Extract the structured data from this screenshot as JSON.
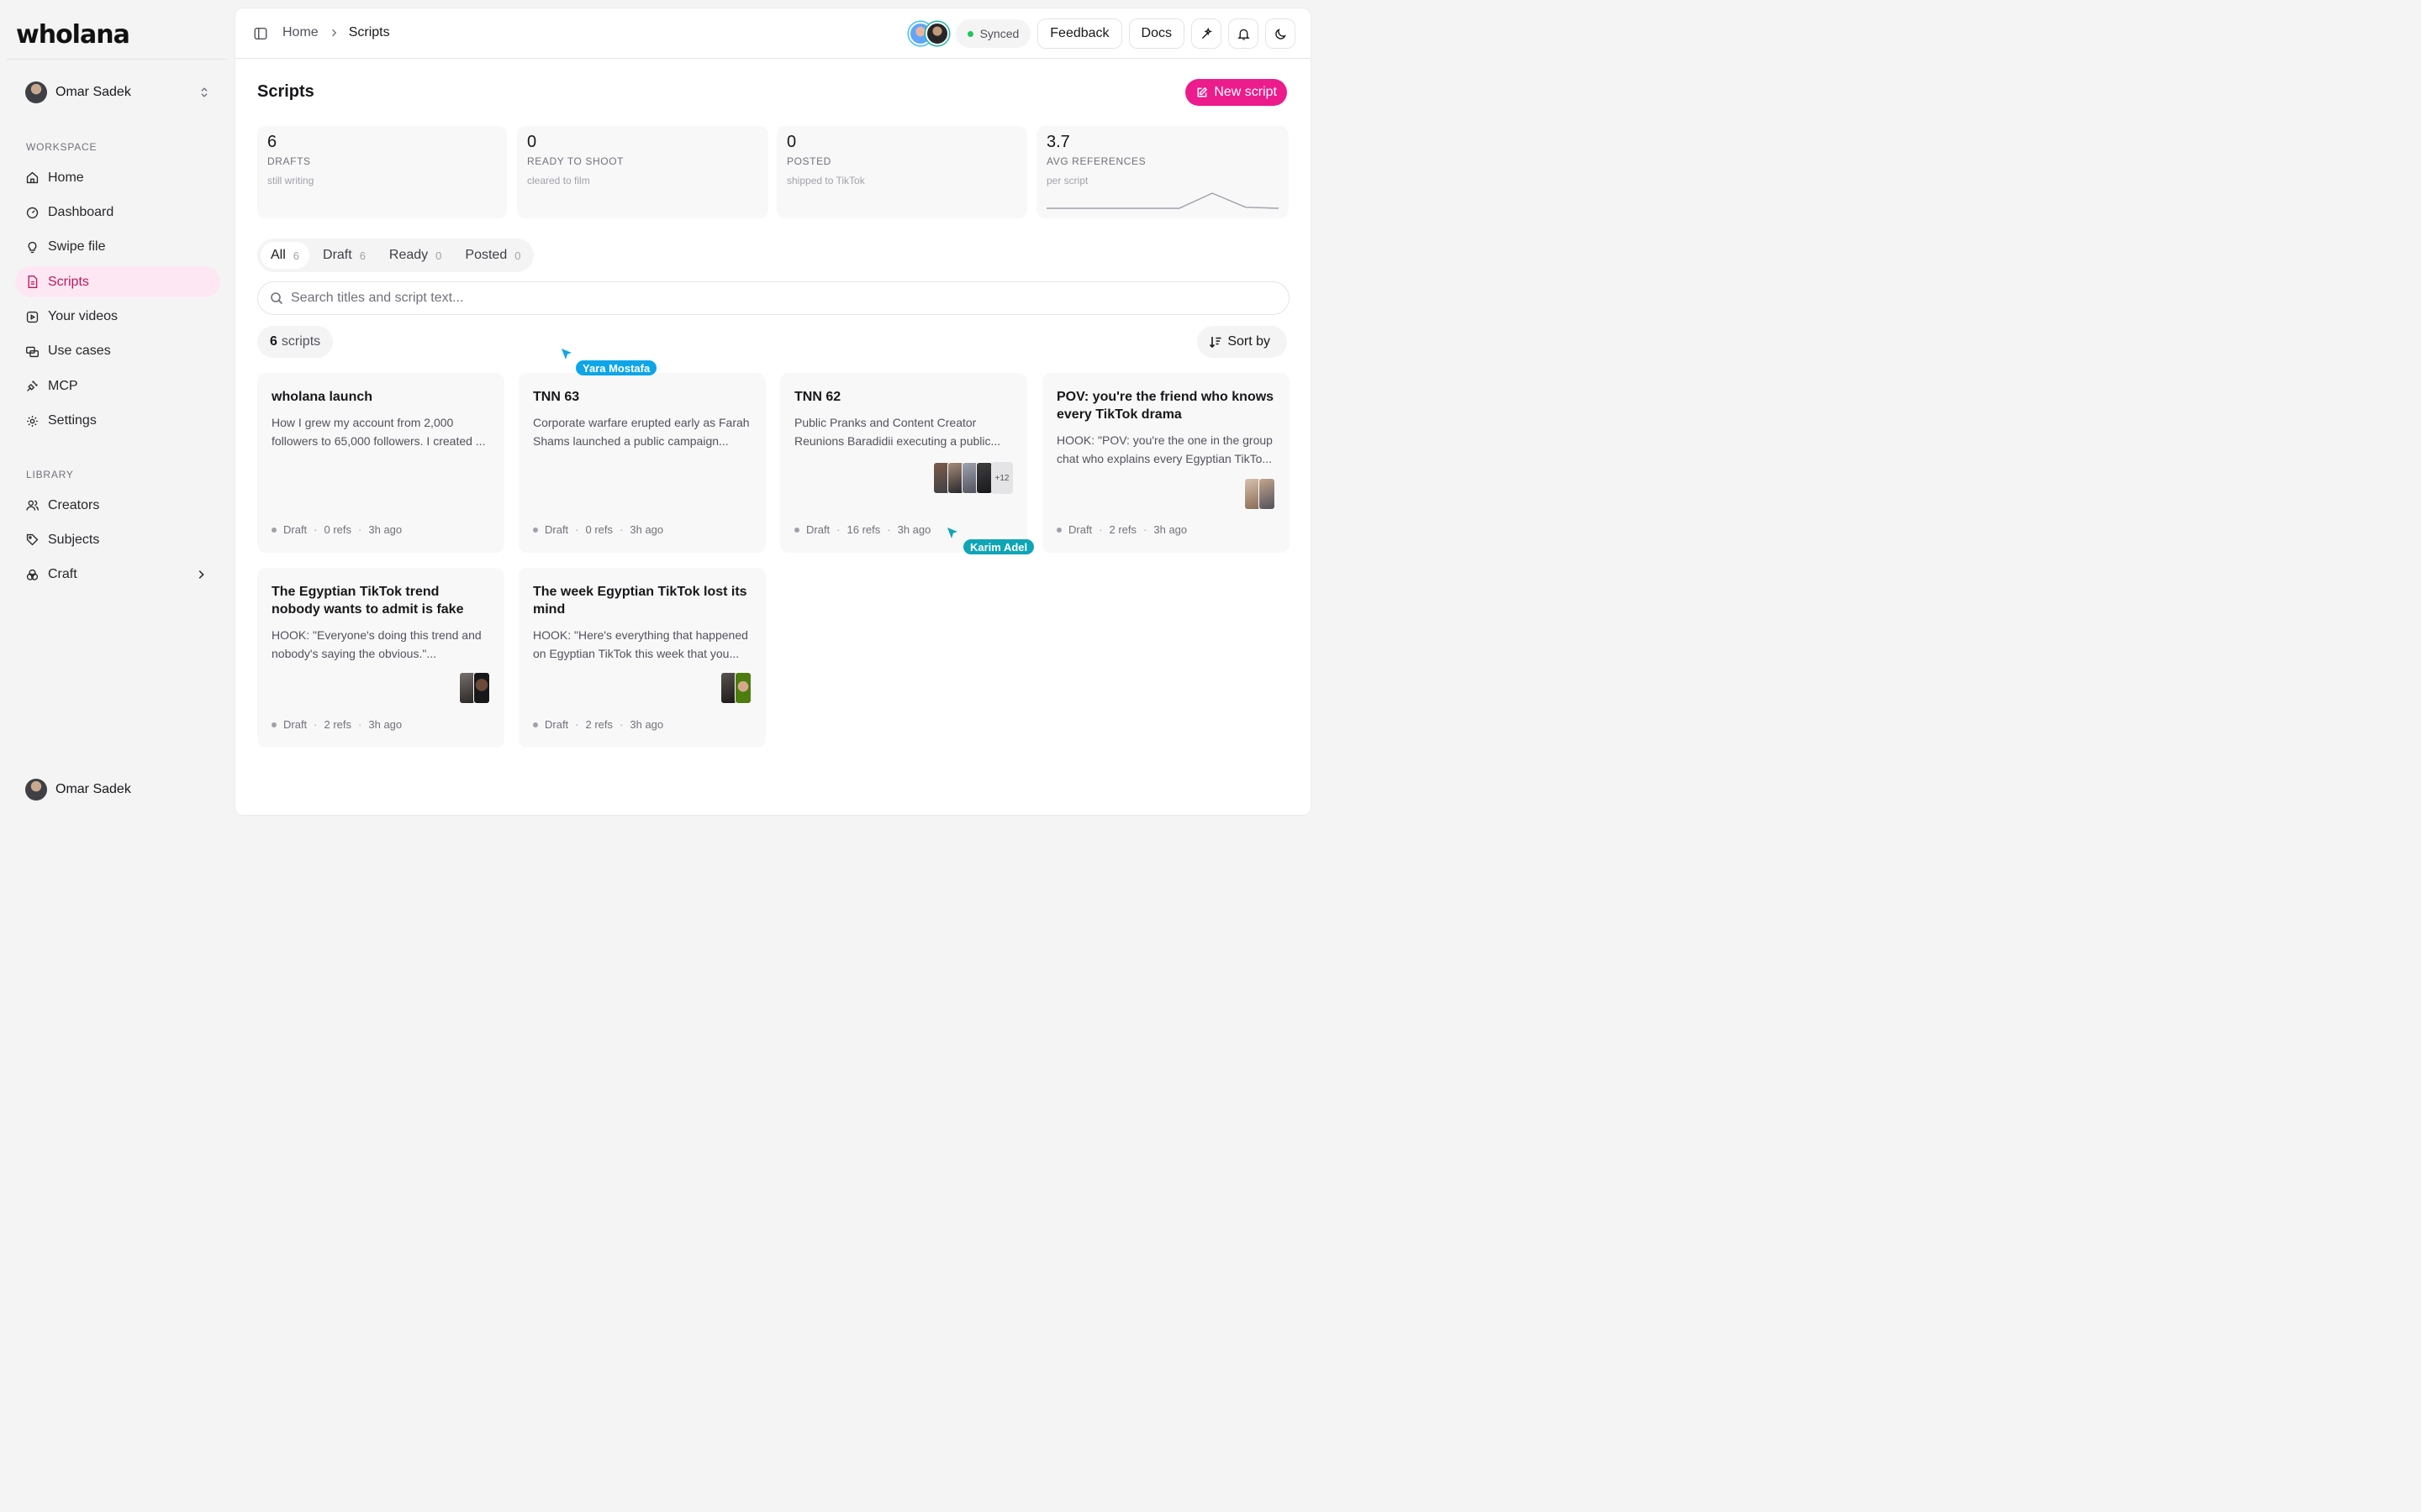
{
  "brand": {
    "logo": "wholana"
  },
  "sidebar": {
    "user": {
      "name": "Omar Sadek"
    },
    "workspace_label": "WORKSPACE",
    "workspace_items": [
      {
        "label": "Home",
        "icon": "home-icon"
      },
      {
        "label": "Dashboard",
        "icon": "gauge-icon"
      },
      {
        "label": "Swipe file",
        "icon": "lightbulb-icon"
      },
      {
        "label": "Scripts",
        "icon": "file-icon",
        "active": true
      },
      {
        "label": "Your videos",
        "icon": "video-icon"
      },
      {
        "label": "Use cases",
        "icon": "cases-icon"
      },
      {
        "label": "MCP",
        "icon": "plug-icon"
      },
      {
        "label": "Settings",
        "icon": "gear-icon"
      }
    ],
    "library_label": "LIBRARY",
    "library_items": [
      {
        "label": "Creators",
        "icon": "users-icon"
      },
      {
        "label": "Subjects",
        "icon": "tag-icon"
      },
      {
        "label": "Craft",
        "icon": "palette-icon"
      }
    ],
    "bottom_user": {
      "name": "Omar Sadek"
    }
  },
  "topbar": {
    "breadcrumb": [
      "Home",
      "Scripts"
    ],
    "sync_status": "Synced",
    "feedback_label": "Feedback",
    "docs_label": "Docs"
  },
  "page": {
    "title": "Scripts",
    "new_button": "New script"
  },
  "stats": [
    {
      "value": "6",
      "label": "DRAFTS",
      "sub": "still writing"
    },
    {
      "value": "0",
      "label": "READY TO SHOOT",
      "sub": "cleared to film"
    },
    {
      "value": "0",
      "label": "POSTED",
      "sub": "shipped to TikTok"
    },
    {
      "value": "3.7",
      "label": "AVG REFERENCES",
      "sub": "per script"
    }
  ],
  "chart_data": {
    "type": "line",
    "values": [
      0,
      0,
      0,
      0,
      0,
      2.8,
      0.2,
      0
    ]
  },
  "filters": {
    "tabs": [
      {
        "label": "All",
        "count": "6",
        "active": true
      },
      {
        "label": "Draft",
        "count": "6"
      },
      {
        "label": "Ready",
        "count": "0"
      },
      {
        "label": "Posted",
        "count": "0"
      }
    ],
    "search_placeholder": "Search titles and script text...",
    "count_number": "6",
    "count_word": "scripts",
    "sort_label": "Sort by"
  },
  "cards": [
    {
      "title": "wholana launch",
      "body": "How I grew my account from 2,000 followers to 65,000 followers. I created ...",
      "status": "Draft",
      "refs": "0 refs",
      "time": "3h ago"
    },
    {
      "title": "TNN 63",
      "body": "Corporate warfare erupted early as Farah Shams launched a public campaign...",
      "status": "Draft",
      "refs": "0 refs",
      "time": "3h ago"
    },
    {
      "title": "TNN 62",
      "body": "Public Pranks and Content Creator Reunions Baradidii executing a public...",
      "status": "Draft",
      "refs": "16 refs",
      "time": "3h ago",
      "thumbs_more": "+12"
    },
    {
      "title": "POV: you're the friend who knows every TikTok drama",
      "body": "HOOK: \"POV: you're the one in the group chat who explains every Egyptian TikTo...",
      "status": "Draft",
      "refs": "2 refs",
      "time": "3h ago"
    },
    {
      "title": "The Egyptian TikTok trend nobody wants to admit is fake",
      "body": "HOOK: \"Everyone's doing this trend and nobody's saying the obvious.\"...",
      "status": "Draft",
      "refs": "2 refs",
      "time": "3h ago"
    },
    {
      "title": "The week Egyptian TikTok lost its mind",
      "body": "HOOK: \"Here's everything that happened on Egyptian TikTok this week that you...",
      "status": "Draft",
      "refs": "2 refs",
      "time": "3h ago"
    }
  ],
  "collaborators": [
    {
      "name": "Yara Mostafa",
      "color": "#0ea5e9"
    },
    {
      "name": "Karim Adel",
      "color": "#0ea5b7"
    }
  ]
}
